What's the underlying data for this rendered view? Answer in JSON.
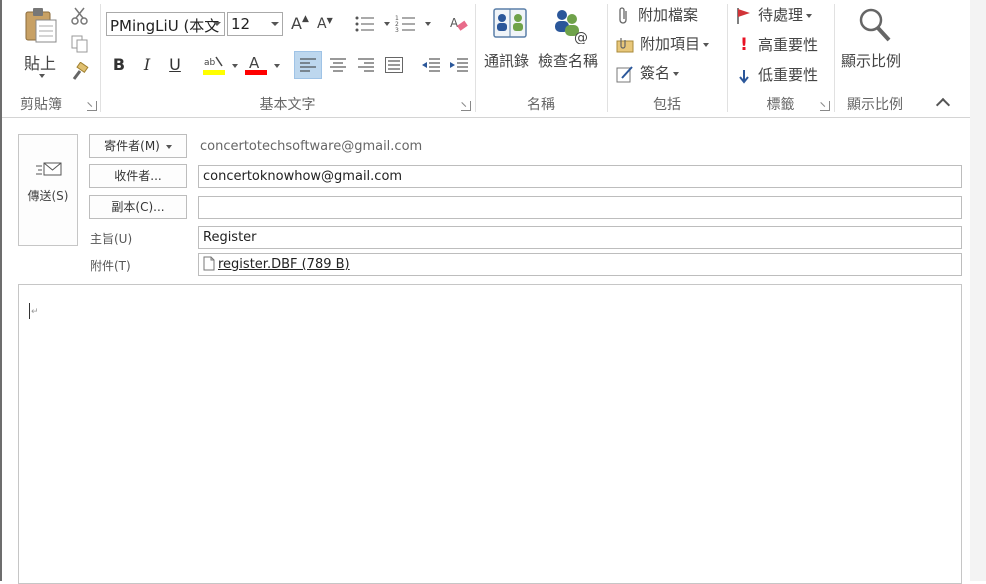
{
  "ribbon": {
    "clipboard": {
      "paste_label": "貼上",
      "group_label": "剪貼簿"
    },
    "basic_text": {
      "font_name": "PMingLiU (本文",
      "font_size": "12",
      "bold": "B",
      "italic": "I",
      "underline": "U",
      "group_label": "基本文字"
    },
    "names": {
      "address_book_label": "通訊錄",
      "check_names_label": "檢查名稱",
      "group_label": "名稱"
    },
    "include": {
      "attach_file_label": "附加檔案",
      "attach_item_label": "附加項目",
      "signature_label": "簽名",
      "group_label": "包括"
    },
    "tags": {
      "follow_up_label": "待處理",
      "high_importance_label": "高重要性",
      "low_importance_label": "低重要性",
      "group_label": "標籤"
    },
    "zoom": {
      "zoom_label": "顯示比例",
      "group_label": "顯示比例"
    }
  },
  "form": {
    "send_label": "傳送(S)",
    "from_button": "寄件者(M)",
    "from_value": "concertotechsoftware@gmail.com",
    "to_button": "收件者...",
    "to_value": "concertoknowhow@gmail.com",
    "cc_button": "副本(C)...",
    "cc_value": "",
    "subject_label": "主旨(U)",
    "subject_value": "Register",
    "attachment_label": "附件(T)",
    "attachment_value": "register.DBF (789 B)"
  },
  "colors": {
    "highlight": "#ffff00",
    "font_color": "#ff0000",
    "follow_up_flag": "#d13438",
    "high_importance": "#e81123",
    "low_importance": "#2b579a",
    "selected_align": "#bdd7ee"
  }
}
